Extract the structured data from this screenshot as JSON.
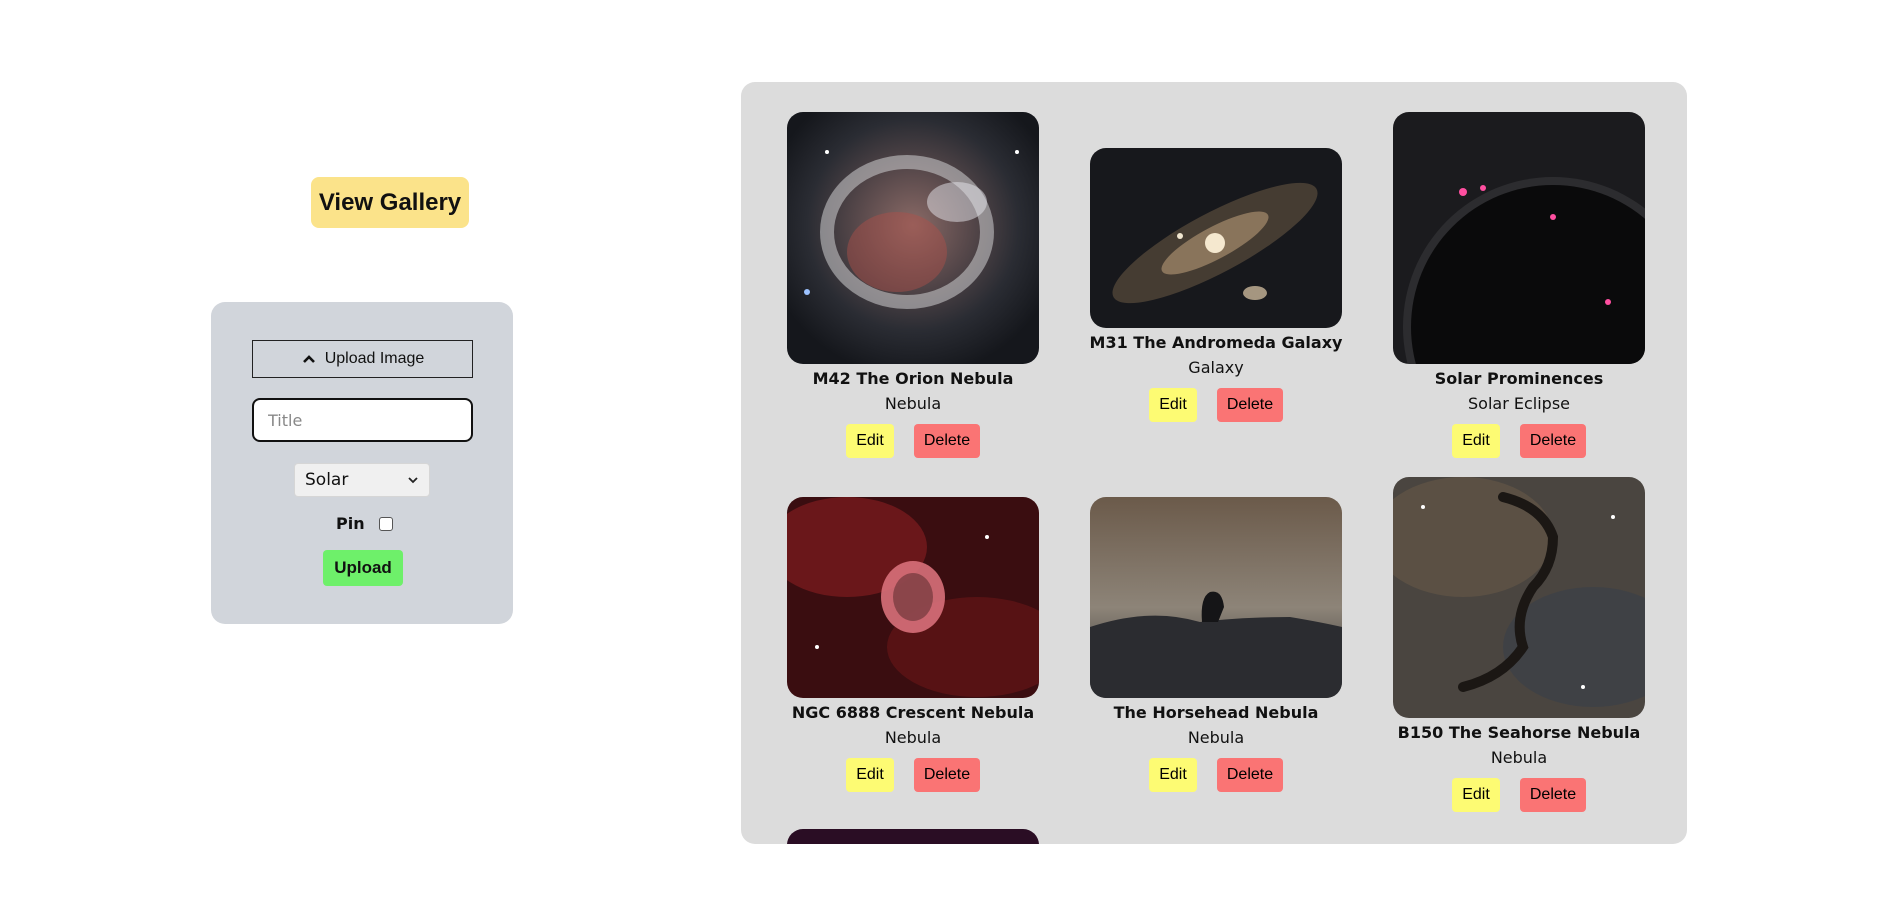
{
  "header": {
    "view_gallery_label": "View Gallery"
  },
  "upload_form": {
    "upload_image_label": "Upload Image",
    "title_placeholder": "Title",
    "category_selected": "Solar",
    "pin_label": "Pin",
    "pin_checked": false,
    "submit_label": "Upload"
  },
  "gallery": {
    "edit_label": "Edit",
    "delete_label": "Delete",
    "items": [
      {
        "title": "M42 The Orion Nebula",
        "category": "Nebula"
      },
      {
        "title": "M31 The Andromeda Galaxy",
        "category": "Galaxy"
      },
      {
        "title": "Solar Prominences",
        "category": "Solar Eclipse"
      },
      {
        "title": "NGC 6888 Crescent Nebula",
        "category": "Nebula"
      },
      {
        "title": "The Horsehead Nebula",
        "category": "Nebula"
      },
      {
        "title": "B150 The Seahorse Nebula",
        "category": "Nebula"
      }
    ]
  },
  "colors": {
    "view_gallery_bg": "#fbe38a",
    "panel_bg": "#d1d5db",
    "gallery_bg": "#dcdcdc",
    "edit_bg": "#fdfb73",
    "delete_bg": "#fa7474",
    "upload_bg": "#6ef06a"
  }
}
